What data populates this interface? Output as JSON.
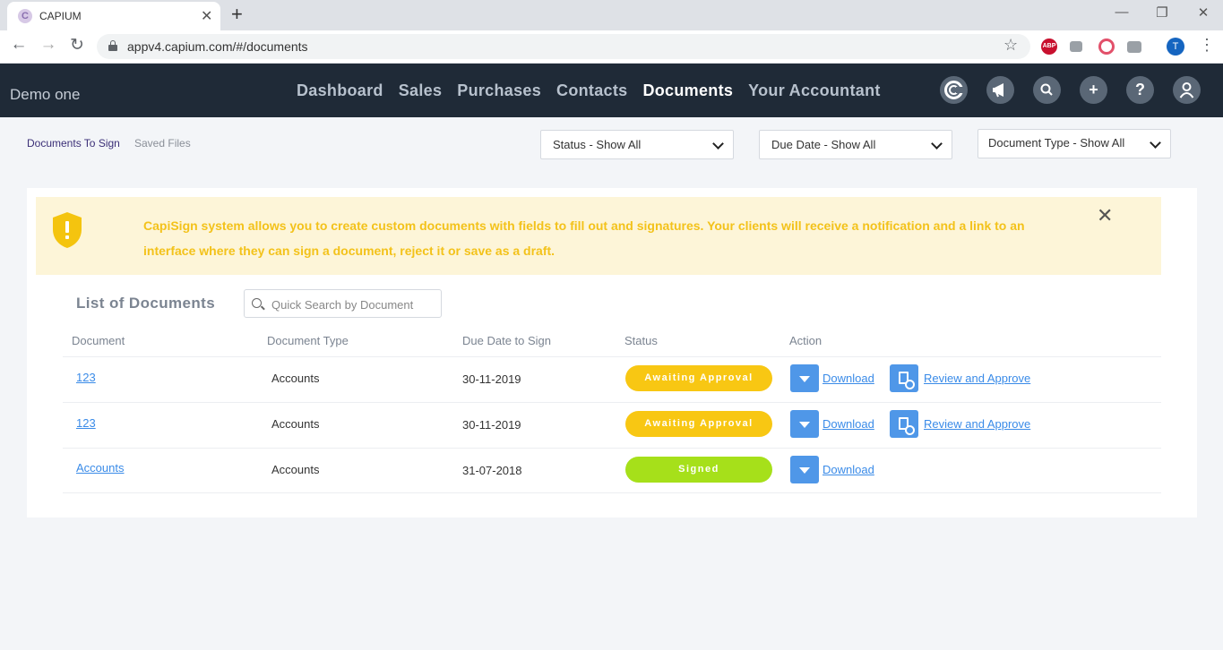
{
  "browser": {
    "tab_title": "CAPIUM",
    "tab_favicon": "C",
    "url": "appv4.capium.com/#/documents",
    "profile_initial": "T",
    "extensions": [
      "ABP"
    ]
  },
  "header": {
    "company": "Demo one",
    "nav": [
      "Dashboard",
      "Sales",
      "Purchases",
      "Contacts",
      "Documents",
      "Your Accountant"
    ],
    "active_nav": "Documents",
    "help_glyph": "?"
  },
  "subtabs": {
    "documents_to_sign": "Documents To Sign",
    "saved_files": "Saved Files"
  },
  "filters": {
    "status": "Status - Show All",
    "due_date": "Due Date - Show All",
    "document_type": "Document Type - Show All"
  },
  "notice": {
    "text": "CapiSign system allows you to create custom documents with fields to fill out and signatures. Your clients will receive a notification and a link to an interface where they can sign a document, reject it or save as a draft.",
    "icon_glyph": "!"
  },
  "list": {
    "title": "List of Documents",
    "search_placeholder": "Quick Search by Document",
    "columns": [
      "Document",
      "Document Type",
      "Due Date to Sign",
      "Status",
      "Action"
    ],
    "rows": [
      {
        "document": "123",
        "type": "Accounts",
        "due": "30-11-2019",
        "status": "Awaiting Approval",
        "download": "Download",
        "review": "Review and Approve"
      },
      {
        "document": "123",
        "type": "Accounts",
        "due": "30-11-2019",
        "status": "Awaiting Approval",
        "download": "Download",
        "review": "Review and Approve"
      },
      {
        "document": "Accounts",
        "type": "Accounts",
        "due": "31-07-2018",
        "status": "Signed",
        "download": "Download",
        "review": ""
      }
    ]
  },
  "colors": {
    "header_bg": "#1f2a37",
    "awaiting": "#f8c713",
    "signed": "#a6e01a",
    "action_blue": "#4f97e8",
    "notice_bg": "#fdf5d8",
    "notice_text": "#f3c21a"
  },
  "icons": {
    "header": [
      "capium-logo-icon",
      "megaphone-icon",
      "search-icon",
      "plus-icon",
      "help-icon",
      "user-icon"
    ]
  }
}
